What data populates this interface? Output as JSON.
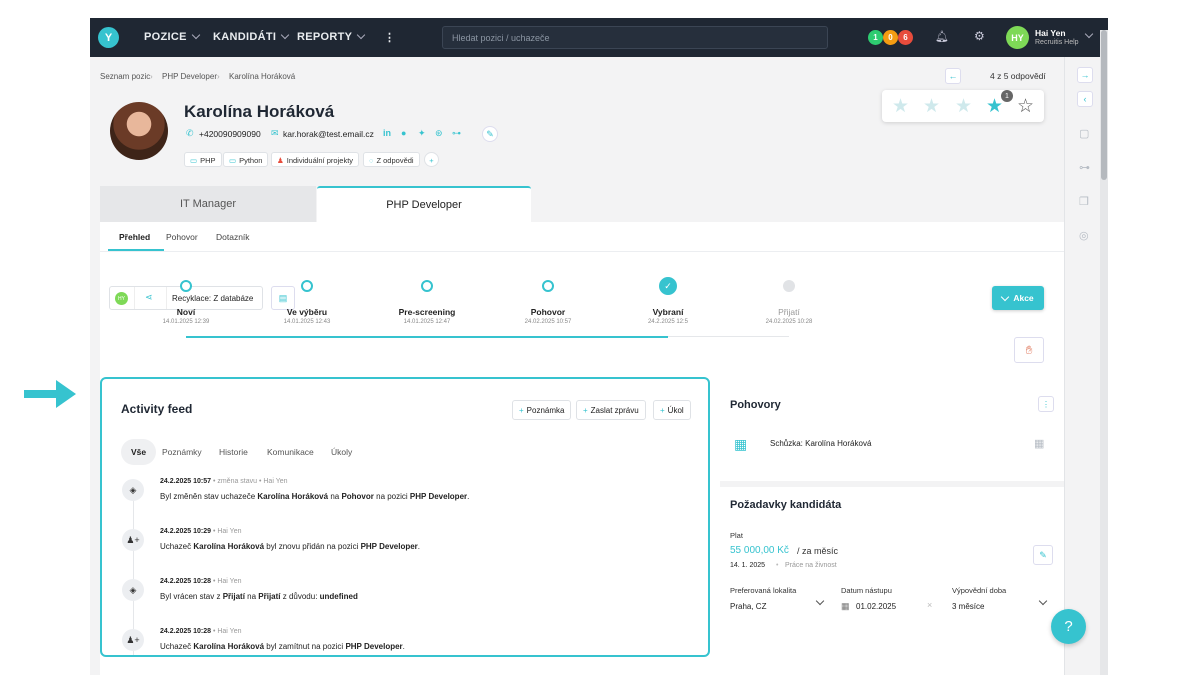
{
  "nav": {
    "logo": "Y",
    "items": [
      "POZICE",
      "KANDIDÁTI",
      "REPORTY"
    ],
    "more": "⋮",
    "search_placeholder": "Hledat pozici / uchazeče",
    "counts": [
      "1",
      "0",
      "6"
    ],
    "count_colors": [
      "#2ecc71",
      "#f39c12",
      "#e74c3c"
    ],
    "user_initials": "HY",
    "user_name": "Hai Yen",
    "user_company": "Recruitis Help"
  },
  "breadcrumb": [
    "Seznam pozic",
    "PHP Developer",
    "Karolína Horáková"
  ],
  "pager": "4 z 5 odpovědí",
  "candidate": {
    "name": "Karolína Horáková",
    "phone": "+420090909090",
    "email": "kar.horak@test.email.cz",
    "tags": [
      "PHP",
      "Python",
      "Individuální projekty",
      "Z odpovědi"
    ],
    "tag_add": "+"
  },
  "rating": {
    "badge": "1",
    "filled": 4,
    "total": 5
  },
  "job_tabs": [
    "IT Manager",
    "PHP Developer"
  ],
  "sub_tabs": [
    "Přehled",
    "Pohovor",
    "Dotazník"
  ],
  "toolbar": {
    "recyclation": "Recyklace: Z databáze",
    "action_label": "Akce"
  },
  "pipeline": [
    {
      "name": "Noví",
      "date": "14.01.2025 12:39"
    },
    {
      "name": "Ve výběru",
      "date": "14.01.2025 12:43"
    },
    {
      "name": "Pre-screening",
      "date": "14.01.2025 12:47"
    },
    {
      "name": "Pohovor",
      "date": "24.02.2025 10:57"
    },
    {
      "name": "Vybraní",
      "date": "24.2.2025 12:5"
    },
    {
      "name": "Přijatí",
      "date": "24.02.2025 10:28"
    }
  ],
  "feed": {
    "title": "Activity feed",
    "buttons": [
      "Poznámka",
      "Zaslat zprávu",
      "Úkol"
    ],
    "tabs": [
      "Vše",
      "Poznámky",
      "Historie",
      "Komunikace",
      "Úkoly"
    ],
    "entries": [
      {
        "date": "24.2.2025 10:57",
        "type": "změna stavu",
        "author": "Hai Yen",
        "pre": "Byl změněn stav uchazeče ",
        "b1": "Karolína Horáková",
        "mid": " na ",
        "b2": "Pohovor",
        "mid2": " na pozici ",
        "b3": "PHP Developer",
        "post": "."
      },
      {
        "date": "24.2.2025 10:29",
        "type": "",
        "author": "Hai Yen",
        "pre": "Uchazeč ",
        "b1": "Karolína Horáková",
        "mid": " byl znovu přidán na pozici ",
        "b2": "PHP Developer",
        "mid2": "",
        "b3": "",
        "post": "."
      },
      {
        "date": "24.2.2025 10:28",
        "type": "",
        "author": "Hai Yen",
        "pre": "Byl vrácen stav z ",
        "b1": "Přijatí",
        "mid": " na ",
        "b2": "Přijatí",
        "mid2": " z důvodu: ",
        "b3": "undefined",
        "post": ""
      },
      {
        "date": "24.2.2025 10:28",
        "type": "",
        "author": "Hai Yen",
        "pre": "Uchazeč ",
        "b1": "Karolína Horáková",
        "mid": " byl zamítnut na pozici ",
        "b2": "PHP Developer",
        "mid2": "",
        "b3": "",
        "post": "."
      }
    ]
  },
  "interviews": {
    "title": "Pohovory",
    "item": "Schůzka: Karolína Horáková"
  },
  "requirements": {
    "title": "Požadavky kandidáta",
    "salary_label": "Plat",
    "salary": "55 000,00 Kč",
    "salary_period": "/ za měsíc",
    "salary_date": "14. 1. 2025",
    "salary_type": "Práce na živnost",
    "location_label": "Preferovaná lokalita",
    "location": "Praha, CZ",
    "start_label": "Datum nástupu",
    "start": "01.02.2025",
    "notice_label": "Výpovědní doba",
    "notice": "3 měsíce"
  },
  "help": "?",
  "colors": {
    "accent": "#36c3cf",
    "nav": "#1f2733"
  }
}
